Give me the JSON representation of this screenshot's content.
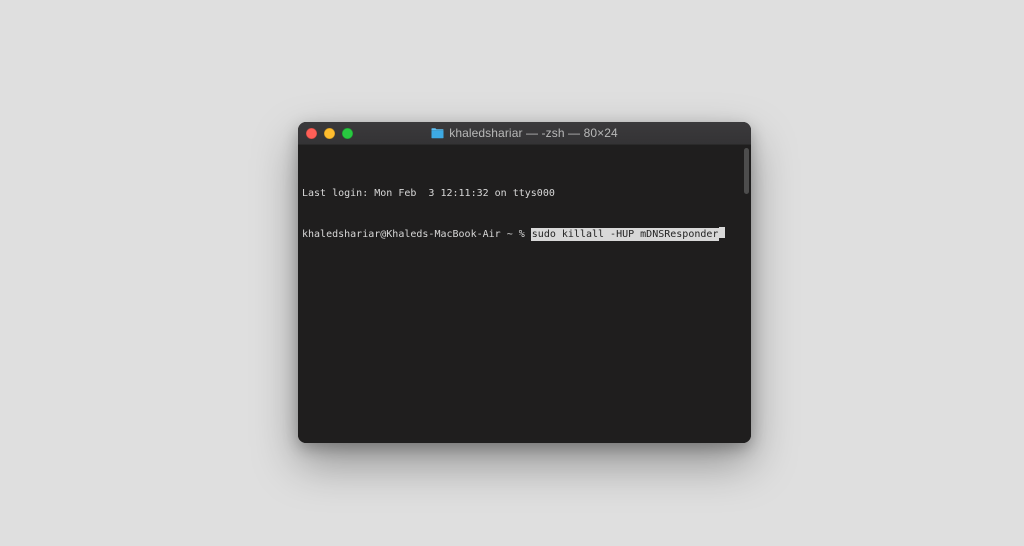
{
  "titlebar": {
    "title": "khaledshariar — -zsh — 80×24"
  },
  "terminal": {
    "last_login_line": "Last login: Mon Feb  3 12:11:32 on ttys000",
    "prompt": "khaledshariar@Khaleds-MacBook-Air ~ % ",
    "entered_command": "sudo killall -HUP mDNSResponder"
  },
  "colors": {
    "close": "#ff5f57",
    "minimize": "#febc2e",
    "maximize": "#28c840",
    "window_bg": "#1f1e1e",
    "titlebar_bg": "#383739"
  }
}
